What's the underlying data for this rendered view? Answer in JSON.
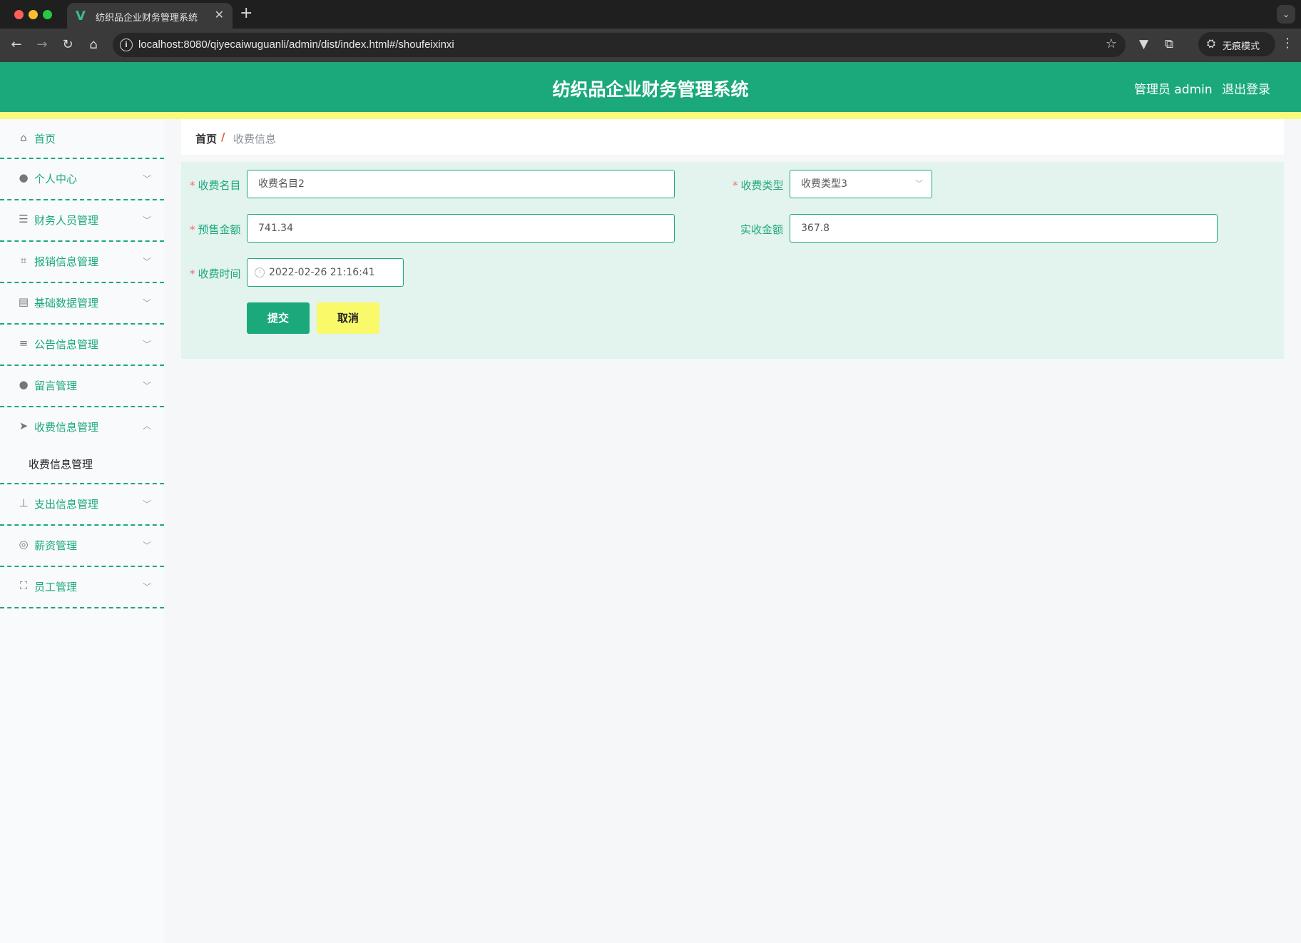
{
  "browser": {
    "tab_title": "纺织品企业财务管理系统",
    "url": "localhost:8080/qiyecaiwuguanli/admin/dist/index.html#/shoufeixinxi",
    "incognito_label": "无痕模式"
  },
  "header": {
    "title": "纺织品企业财务管理系统",
    "user": "管理员 admin",
    "logout": "退出登录"
  },
  "sidebar": {
    "items": [
      {
        "label": "首页",
        "icon": "home-icon"
      },
      {
        "label": "个人中心",
        "icon": "user-icon"
      },
      {
        "label": "财务人员管理",
        "icon": "sliders-icon"
      },
      {
        "label": "报销信息管理",
        "icon": "crop-icon"
      },
      {
        "label": "基础数据管理",
        "icon": "clipboard-icon"
      },
      {
        "label": "公告信息管理",
        "icon": "list-icon"
      },
      {
        "label": "留言管理",
        "icon": "user-icon"
      },
      {
        "label": "收费信息管理",
        "icon": "send-icon",
        "expanded": true,
        "children": [
          "收费信息管理"
        ]
      },
      {
        "label": "支出信息管理",
        "icon": "stamp-icon"
      },
      {
        "label": "薪资管理",
        "icon": "compass-icon"
      },
      {
        "label": "员工管理",
        "icon": "fullscreen-icon"
      }
    ]
  },
  "breadcrumb": {
    "home": "首页",
    "separator": "/",
    "current": "收费信息"
  },
  "form": {
    "item_name_label": "收费名目",
    "item_name_value": "收费名目2",
    "type_label": "收费类型",
    "type_value": "收费类型3",
    "presale_label": "预售金额",
    "presale_value": "741.34",
    "actual_label": "实收金额",
    "actual_value": "367.8",
    "time_label": "收费时间",
    "time_value": "2022-02-26 21:16:41",
    "submit": "提交",
    "cancel": "取消"
  },
  "colors": {
    "primary": "#1ba97b",
    "accent_yellow": "#f9f97c",
    "required": "#f56c6c",
    "panel_bg": "#e3f3ee"
  }
}
